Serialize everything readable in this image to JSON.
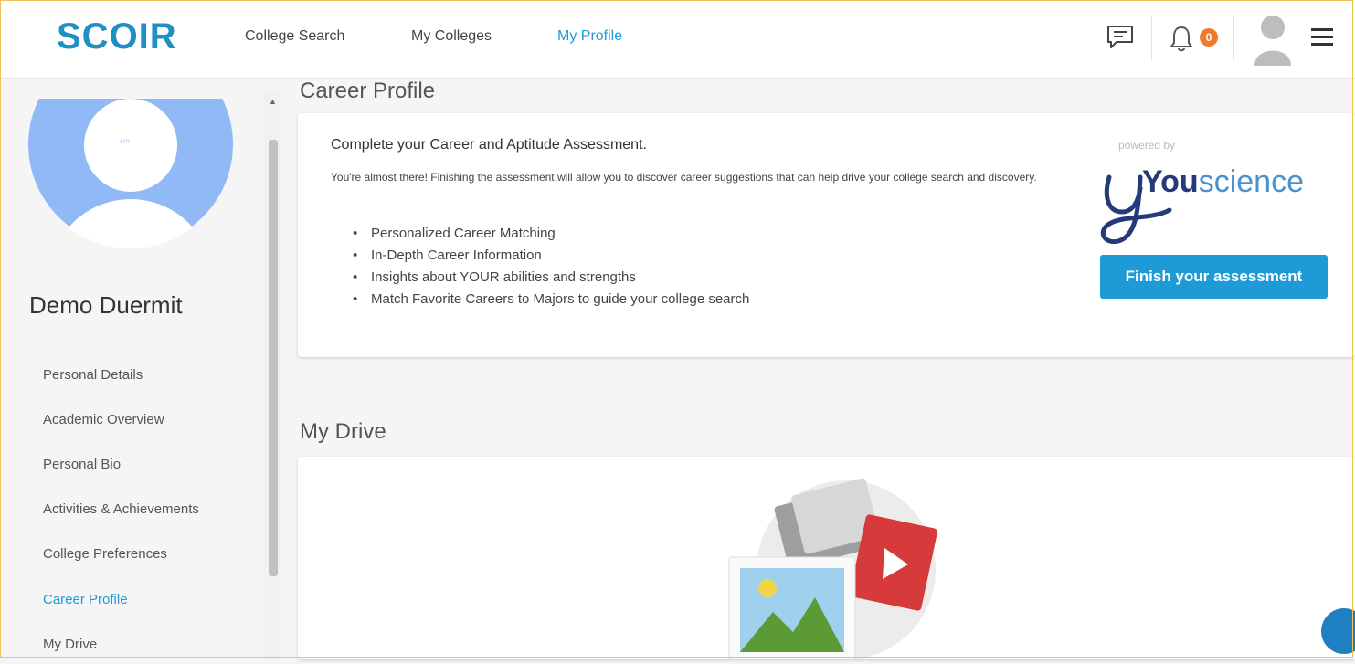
{
  "header": {
    "logo": "SCOIR",
    "nav": [
      {
        "label": "College Search"
      },
      {
        "label": "My Colleges"
      },
      {
        "label": "My Profile"
      }
    ],
    "notification_count": "0"
  },
  "sidebar": {
    "avatar_tiny_text": "sm",
    "name": "Demo Duermit",
    "items": [
      {
        "label": "Personal Details"
      },
      {
        "label": "Academic Overview"
      },
      {
        "label": "Personal Bio"
      },
      {
        "label": "Activities & Achievements"
      },
      {
        "label": "College Preferences"
      },
      {
        "label": "Career Profile"
      },
      {
        "label": "My Drive"
      }
    ]
  },
  "career_profile": {
    "title": "Career Profile",
    "heading": "Complete your Career and Aptitude Assessment.",
    "description": "You're almost there! Finishing the assessment will allow you to discover career suggestions that can help drive your college search and discovery.",
    "bullets": [
      "Personalized Career Matching",
      "In-Depth Career Information",
      "Insights about YOUR abilities and strengths",
      "Match Favorite Careers to Majors to guide your college search"
    ],
    "powered_by": "powered by",
    "brand_bold": "You",
    "brand_rest": "science",
    "button_label": "Finish your assessment"
  },
  "drive": {
    "title": "My Drive"
  },
  "colors": {
    "accent": "#1e9bd6",
    "badge": "#f07a2a",
    "avatar_bg": "#91b9f5"
  }
}
